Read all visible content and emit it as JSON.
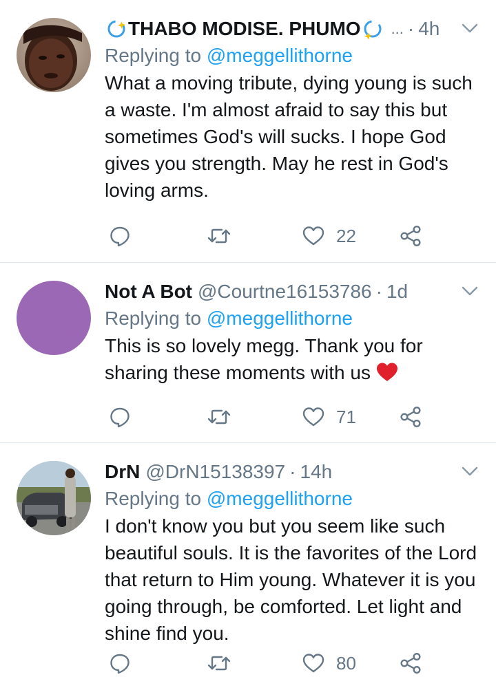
{
  "tweets": [
    {
      "name": "THABO MODISE. PHUMO",
      "handle": "",
      "ellipsis": "...",
      "dot": "·",
      "time": "4h",
      "replying_prefix": "Replying to",
      "replying_to": "@meggellithorne",
      "body": "What a moving tribute, dying young is such a waste. I'm almost afraid to say this but sometimes God's will sucks. I hope God gives you strength. May he rest in God's loving arms.",
      "likes": "22"
    },
    {
      "name": "Not A Bot",
      "handle": "@Courtne16153786",
      "dot": "·",
      "time": "1d",
      "replying_prefix": "Replying to",
      "replying_to": "@meggellithorne",
      "body": "This is so lovely megg. Thank you for sharing these moments with us",
      "likes": "71"
    },
    {
      "name": "DrN",
      "handle": "@DrN15138397",
      "dot": "·",
      "time": "14h",
      "replying_prefix": "Replying to",
      "replying_to": "@meggellithorne",
      "body": "I don't know you but you seem like such beautiful souls. It is the favorites of the Lord that return to Him young. Whatever it is you going through, be comforted. Let light and shine find you.",
      "likes": "80"
    }
  ],
  "icons": {
    "reply": "reply-icon",
    "retweet": "retweet-icon",
    "like": "heart-icon",
    "share": "share-icon",
    "menu": "chevron-down-icon",
    "verified_emoji": "dizzy-sparkle-emoji",
    "heart_emoji": "red-heart-emoji"
  },
  "colors": {
    "text": "#14171a",
    "secondary": "#657786",
    "link": "#1da1f2",
    "divider": "#e1e8ed",
    "avatar_purple": "#9b68b5",
    "heart_red": "#e0202b"
  }
}
